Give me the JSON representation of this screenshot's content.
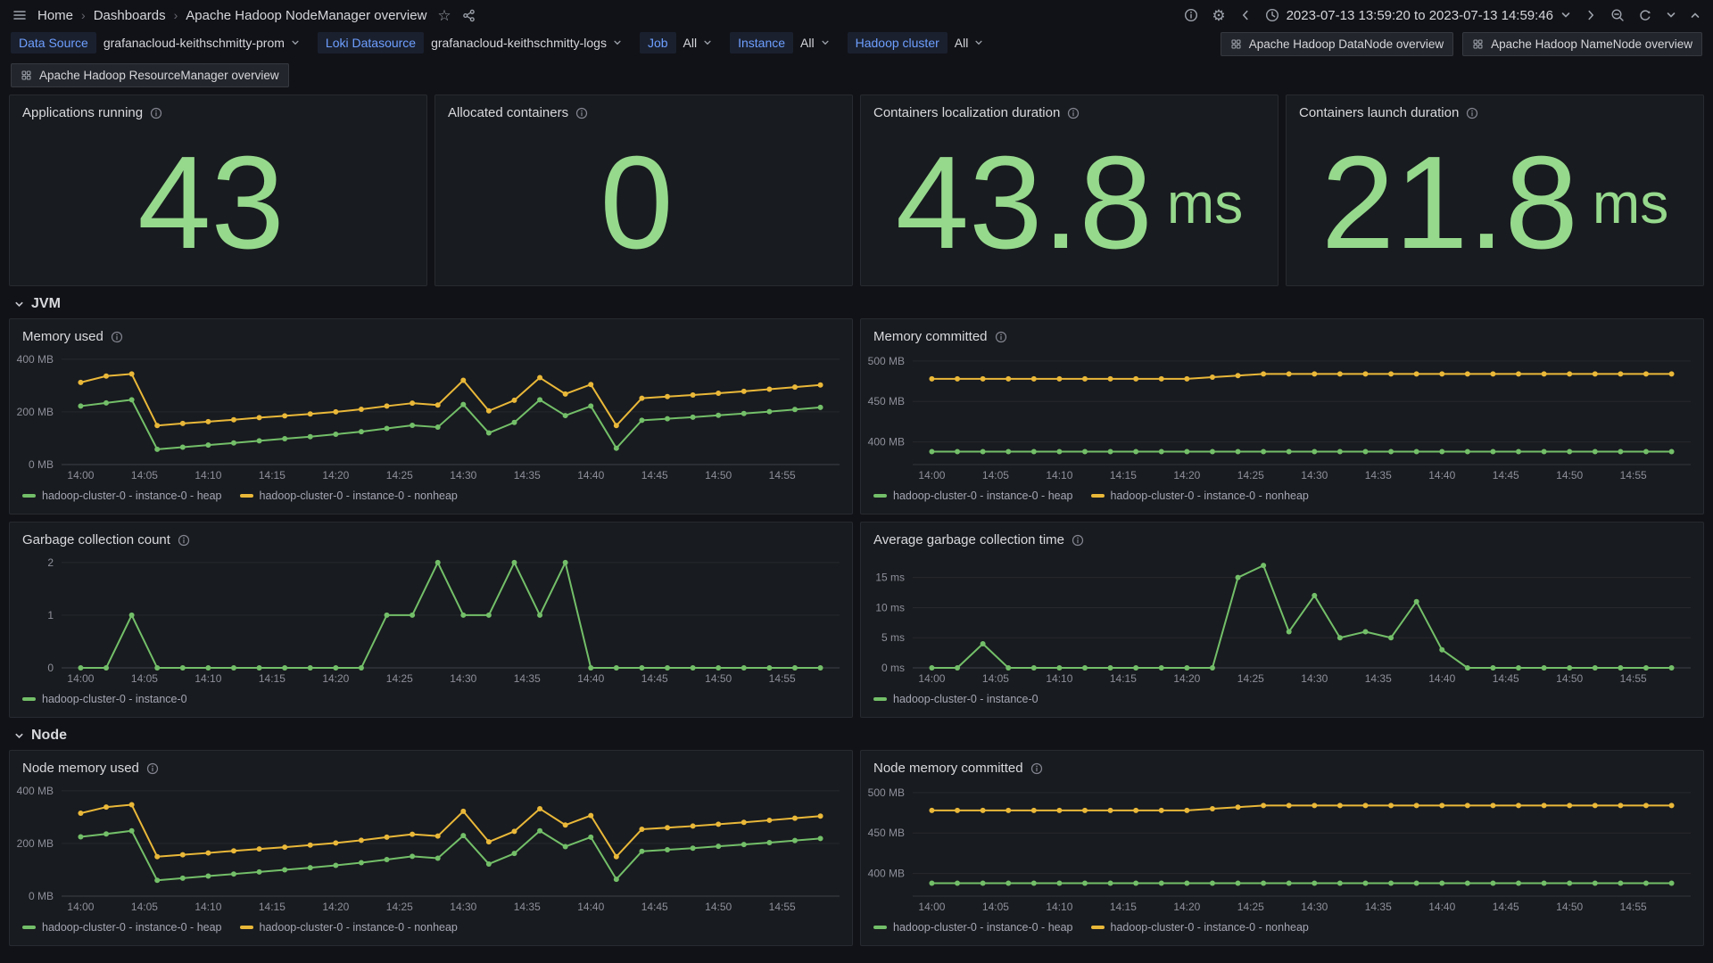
{
  "nav": {
    "breadcrumb": [
      "Home",
      "Dashboards",
      "Apache Hadoop NodeManager overview"
    ],
    "time_range": "2023-07-13 13:59:20 to 2023-07-13 14:59:46"
  },
  "icons": {
    "gear": "⚙",
    "star": "☆"
  },
  "toolbar": {
    "variables": [
      {
        "label": "Data Source",
        "value": "grafanacloud-keithschmitty-prom"
      },
      {
        "label": "Loki Datasource",
        "value": "grafanacloud-keithschmitty-logs"
      },
      {
        "label": "Job",
        "value": "All"
      },
      {
        "label": "Instance",
        "value": "All"
      },
      {
        "label": "Hadoop cluster",
        "value": "All"
      }
    ],
    "links": [
      "Apache Hadoop DataNode overview",
      "Apache Hadoop NameNode overview",
      "Apache Hadoop ResourceManager overview"
    ]
  },
  "stats": [
    {
      "title": "Applications running",
      "value": "43",
      "unit": ""
    },
    {
      "title": "Allocated containers",
      "value": "0",
      "unit": ""
    },
    {
      "title": "Containers localization duration",
      "value": "43.8",
      "unit": "ms"
    },
    {
      "title": "Containers launch duration",
      "value": "21.8",
      "unit": "ms"
    }
  ],
  "sections": [
    {
      "label": "JVM"
    },
    {
      "label": "Node"
    }
  ],
  "colors": {
    "green": "#73bf69",
    "yellow": "#eab839",
    "stat_green": "#96d98d"
  },
  "chart_data": [
    {
      "type": "line",
      "title": "Memory used",
      "y_min": 0,
      "y_max": 430,
      "y_ticks": [
        {
          "value": 0,
          "label": "0 MB"
        },
        {
          "value": 200,
          "label": "200 MB"
        },
        {
          "value": 400,
          "label": "400 MB"
        }
      ],
      "x_min": -1.5,
      "x_max": 59.5,
      "x_tick_step": 5,
      "x_ticks": [
        "14:00",
        "14:05",
        "14:10",
        "14:15",
        "14:20",
        "14:25",
        "14:30",
        "14:35",
        "14:40",
        "14:45",
        "14:50",
        "14:55"
      ],
      "x_start_minute": 0,
      "x_step_minutes": 2,
      "series": [
        {
          "name": "hadoop-cluster-0 - instance-0 - heap",
          "color": "#73bf69",
          "values": [
            222,
            234,
            246,
            58,
            66,
            74,
            82,
            90,
            98,
            106,
            115,
            125,
            137,
            149,
            142,
            228,
            120,
            160,
            246,
            186,
            222,
            62,
            168,
            174,
            180,
            187,
            194,
            201,
            209,
            217
          ]
        },
        {
          "name": "hadoop-cluster-0 - instance-0 - nonheap",
          "color": "#eab839",
          "values": [
            312,
            336,
            344,
            148,
            156,
            163,
            170,
            178,
            185,
            192,
            200,
            210,
            222,
            233,
            226,
            320,
            204,
            244,
            330,
            268,
            304,
            148,
            252,
            258,
            264,
            271,
            278,
            286,
            294,
            302
          ]
        }
      ]
    },
    {
      "type": "line",
      "title": "Memory committed",
      "y_min": 372,
      "y_max": 512,
      "y_ticks": [
        {
          "value": 400,
          "label": "400 MB"
        },
        {
          "value": 450,
          "label": "450 MB"
        },
        {
          "value": 500,
          "label": "500 MB"
        }
      ],
      "x_min": -1.5,
      "x_max": 59.5,
      "x_tick_step": 5,
      "x_ticks": [
        "14:00",
        "14:05",
        "14:10",
        "14:15",
        "14:20",
        "14:25",
        "14:30",
        "14:35",
        "14:40",
        "14:45",
        "14:50",
        "14:55"
      ],
      "x_start_minute": 0,
      "x_step_minutes": 2,
      "series": [
        {
          "name": "hadoop-cluster-0 - instance-0 - heap",
          "color": "#73bf69",
          "values": [
            388,
            388,
            388,
            388,
            388,
            388,
            388,
            388,
            388,
            388,
            388,
            388,
            388,
            388,
            388,
            388,
            388,
            388,
            388,
            388,
            388,
            388,
            388,
            388,
            388,
            388,
            388,
            388,
            388,
            388
          ]
        },
        {
          "name": "hadoop-cluster-0 - instance-0 - nonheap",
          "color": "#eab839",
          "values": [
            478,
            478,
            478,
            478,
            478,
            478,
            478,
            478,
            478,
            478,
            478,
            480,
            482,
            484,
            484,
            484,
            484,
            484,
            484,
            484,
            484,
            484,
            484,
            484,
            484,
            484,
            484,
            484,
            484,
            484
          ]
        }
      ]
    },
    {
      "type": "line",
      "title": "Garbage collection count",
      "y_min": 0,
      "y_max": 2.15,
      "y_ticks": [
        {
          "value": 0,
          "label": "0"
        },
        {
          "value": 1,
          "label": "1"
        },
        {
          "value": 2,
          "label": "2"
        }
      ],
      "x_min": -1.5,
      "x_max": 59.5,
      "x_tick_step": 5,
      "x_ticks": [
        "14:00",
        "14:05",
        "14:10",
        "14:15",
        "14:20",
        "14:25",
        "14:30",
        "14:35",
        "14:40",
        "14:45",
        "14:50",
        "14:55"
      ],
      "x_start_minute": 0,
      "x_step_minutes": 2,
      "series": [
        {
          "name": "hadoop-cluster-0 - instance-0",
          "color": "#73bf69",
          "values": [
            0,
            0,
            1,
            0,
            0,
            0,
            0,
            0,
            0,
            0,
            0,
            0,
            1,
            1,
            2,
            1,
            1,
            2,
            1,
            2,
            0,
            0,
            0,
            0,
            0,
            0,
            0,
            0,
            0,
            0
          ]
        }
      ]
    },
    {
      "type": "line",
      "title": "Average garbage collection time",
      "y_min": 0,
      "y_max": 18.8,
      "y_ticks": [
        {
          "value": 0,
          "label": "0 ms"
        },
        {
          "value": 5,
          "label": "5 ms"
        },
        {
          "value": 10,
          "label": "10 ms"
        },
        {
          "value": 15,
          "label": "15 ms"
        }
      ],
      "x_min": -1.5,
      "x_max": 59.5,
      "x_tick_step": 5,
      "x_ticks": [
        "14:00",
        "14:05",
        "14:10",
        "14:15",
        "14:20",
        "14:25",
        "14:30",
        "14:35",
        "14:40",
        "14:45",
        "14:50",
        "14:55"
      ],
      "x_start_minute": 0,
      "x_step_minutes": 2,
      "series": [
        {
          "name": "hadoop-cluster-0 - instance-0",
          "color": "#73bf69",
          "values": [
            0,
            0,
            4,
            0,
            0,
            0,
            0,
            0,
            0,
            0,
            0,
            0,
            15,
            17,
            6,
            12,
            5,
            6,
            5,
            11,
            3,
            0,
            0,
            0,
            0,
            0,
            0,
            0,
            0,
            0
          ]
        }
      ]
    },
    {
      "type": "line",
      "title": "Node memory used",
      "y_min": 0,
      "y_max": 430,
      "y_ticks": [
        {
          "value": 0,
          "label": "0 MB"
        },
        {
          "value": 200,
          "label": "200 MB"
        },
        {
          "value": 400,
          "label": "400 MB"
        }
      ],
      "x_min": -1.5,
      "x_max": 59.5,
      "x_tick_step": 5,
      "x_ticks": [
        "14:00",
        "14:05",
        "14:10",
        "14:15",
        "14:20",
        "14:25",
        "14:30",
        "14:35",
        "14:40",
        "14:45",
        "14:50",
        "14:55"
      ],
      "x_start_minute": 0,
      "x_step_minutes": 2,
      "series": [
        {
          "name": "hadoop-cluster-0 - instance-0 - heap",
          "color": "#73bf69",
          "values": [
            225,
            236,
            248,
            60,
            68,
            76,
            84,
            92,
            100,
            108,
            117,
            127,
            139,
            151,
            144,
            230,
            122,
            162,
            248,
            188,
            224,
            64,
            170,
            176,
            182,
            189,
            196,
            203,
            211,
            219
          ]
        },
        {
          "name": "hadoop-cluster-0 - instance-0 - nonheap",
          "color": "#eab839",
          "values": [
            315,
            338,
            347,
            150,
            157,
            164,
            172,
            179,
            186,
            194,
            202,
            212,
            224,
            235,
            228,
            322,
            206,
            246,
            332,
            270,
            306,
            150,
            254,
            260,
            266,
            273,
            280,
            288,
            296,
            304
          ]
        }
      ]
    },
    {
      "type": "line",
      "title": "Node memory committed",
      "y_min": 372,
      "y_max": 512,
      "y_ticks": [
        {
          "value": 400,
          "label": "400 MB"
        },
        {
          "value": 450,
          "label": "450 MB"
        },
        {
          "value": 500,
          "label": "500 MB"
        }
      ],
      "x_min": -1.5,
      "x_max": 59.5,
      "x_tick_step": 5,
      "x_ticks": [
        "14:00",
        "14:05",
        "14:10",
        "14:15",
        "14:20",
        "14:25",
        "14:30",
        "14:35",
        "14:40",
        "14:45",
        "14:50",
        "14:55"
      ],
      "x_start_minute": 0,
      "x_step_minutes": 2,
      "series": [
        {
          "name": "hadoop-cluster-0 - instance-0 - heap",
          "color": "#73bf69",
          "values": [
            388,
            388,
            388,
            388,
            388,
            388,
            388,
            388,
            388,
            388,
            388,
            388,
            388,
            388,
            388,
            388,
            388,
            388,
            388,
            388,
            388,
            388,
            388,
            388,
            388,
            388,
            388,
            388,
            388,
            388
          ]
        },
        {
          "name": "hadoop-cluster-0 - instance-0 - nonheap",
          "color": "#eab839",
          "values": [
            478,
            478,
            478,
            478,
            478,
            478,
            478,
            478,
            478,
            478,
            478,
            480,
            482,
            484,
            484,
            484,
            484,
            484,
            484,
            484,
            484,
            484,
            484,
            484,
            484,
            484,
            484,
            484,
            484,
            484
          ]
        }
      ]
    }
  ]
}
